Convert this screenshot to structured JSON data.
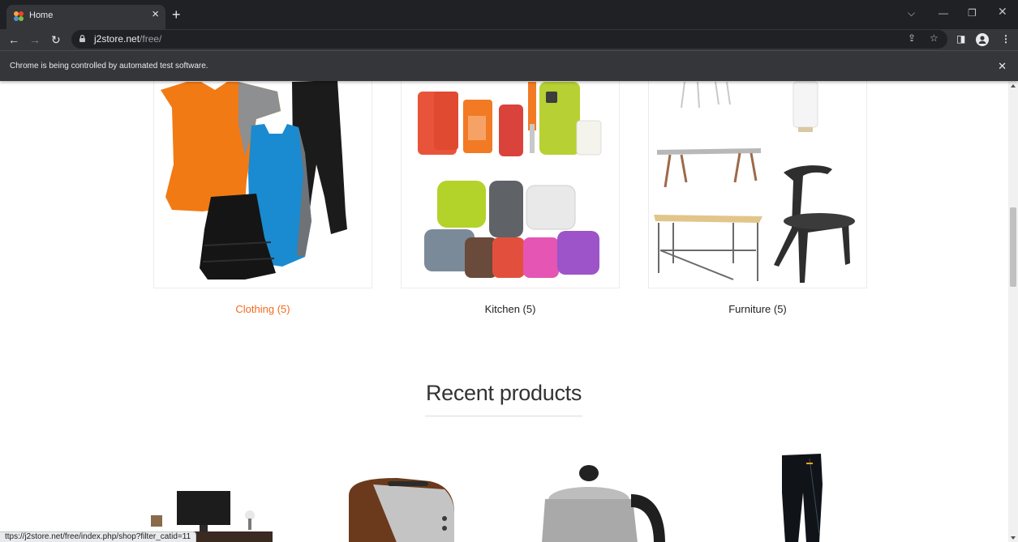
{
  "browser": {
    "tab_title": "Home",
    "url_host": "j2store.net",
    "url_path": "/free/",
    "infobar_text": "Chrome is being controlled by automated test software.",
    "status_url": "ttps://j2store.net/free/index.php/shop?filter_catid=11"
  },
  "categories": [
    {
      "label": "Clothing (5)",
      "active": true
    },
    {
      "label": "Kitchen (5)",
      "active": false
    },
    {
      "label": "Furniture (5)",
      "active": false
    }
  ],
  "recent": {
    "title": "Recent products"
  },
  "colors": {
    "accent": "#f26b1d",
    "chrome_dark": "#202124",
    "chrome_mid": "#35363a"
  }
}
